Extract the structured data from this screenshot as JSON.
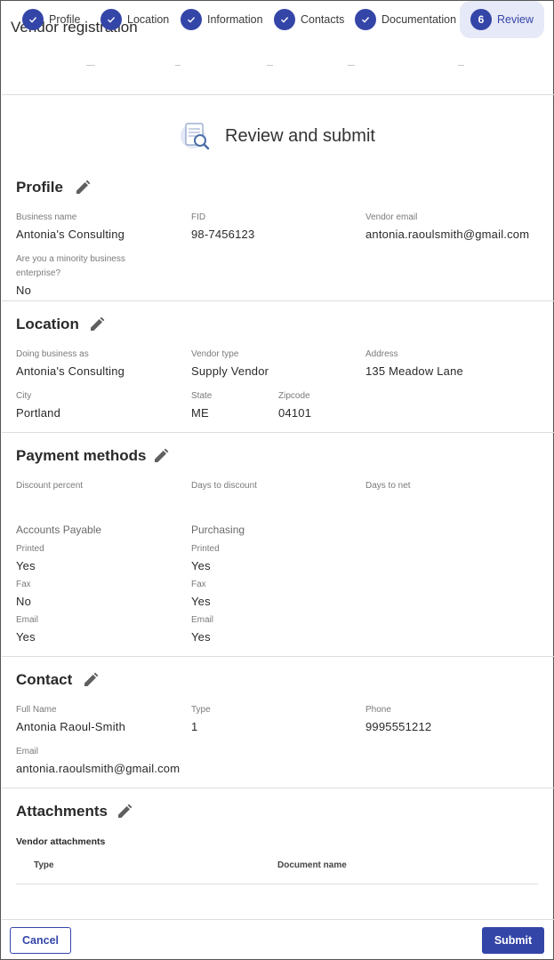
{
  "dialog": {
    "title": "Vendor registration"
  },
  "stepper": {
    "steps": [
      {
        "label": "Profile",
        "state": "done"
      },
      {
        "label": "Location",
        "state": "done"
      },
      {
        "label": "Information",
        "state": "done"
      },
      {
        "label": "Contacts",
        "state": "done"
      },
      {
        "label": "Documentation",
        "state": "done"
      },
      {
        "label": "Review",
        "state": "active",
        "number": "6"
      }
    ]
  },
  "review": {
    "title": "Review and submit"
  },
  "profile": {
    "title": "Profile",
    "business_name": {
      "label": "Business name",
      "value": "Antonia's Consulting"
    },
    "fid": {
      "label": "FID",
      "value": "98-7456123"
    },
    "vendor_email": {
      "label": "Vendor email",
      "value": "antonia.raoulsmith@gmail.com"
    },
    "minority": {
      "label_line1": "Are you a minority business",
      "label_line2": "enterprise?",
      "value": "No"
    }
  },
  "location": {
    "title": "Location",
    "dba": {
      "label": "Doing business as",
      "value": "Antonia's Consulting"
    },
    "vendor_type": {
      "label": "Vendor type",
      "value": "Supply Vendor"
    },
    "address": {
      "label": "Address",
      "value": "135 Meadow Lane"
    },
    "city": {
      "label": "City",
      "value": "Portland"
    },
    "state": {
      "label": "State",
      "value": "ME"
    },
    "zipcode": {
      "label": "Zipcode",
      "value": "04101"
    }
  },
  "payment": {
    "title": "Payment methods",
    "discount_percent": {
      "label": "Discount percent"
    },
    "days_to_discount": {
      "label": "Days to discount"
    },
    "days_to_net": {
      "label": "Days to net"
    },
    "accounts_payable": {
      "heading": "Accounts Payable",
      "printed": {
        "label": "Printed",
        "value": "Yes"
      },
      "fax": {
        "label": "Fax",
        "value": "No"
      },
      "email": {
        "label": "Email",
        "value": "Yes"
      }
    },
    "purchasing": {
      "heading": "Purchasing",
      "printed": {
        "label": "Printed",
        "value": "Yes"
      },
      "fax": {
        "label": "Fax",
        "value": "Yes"
      },
      "email": {
        "label": "Email",
        "value": "Yes"
      }
    }
  },
  "contact": {
    "title": "Contact",
    "full_name": {
      "label": "Full Name",
      "value": "Antonia Raoul-Smith"
    },
    "type": {
      "label": "Type",
      "value": "1"
    },
    "phone": {
      "label": "Phone",
      "value": "9995551212"
    },
    "email": {
      "label": "Email",
      "value": "antonia.raoulsmith@gmail.com"
    }
  },
  "attachments": {
    "title": "Attachments",
    "subtitle": "Vendor attachments",
    "columns": [
      "Type",
      "Document name"
    ]
  },
  "footer": {
    "cancel_label": "Cancel",
    "submit_label": "Submit"
  },
  "colors": {
    "accent": "#3445a8",
    "active_step_bg": "#e6e9f7"
  },
  "icons": {
    "close": "close-icon",
    "step_done": "check-icon",
    "edit": "pencil-icon",
    "review": "document-search-icon"
  }
}
